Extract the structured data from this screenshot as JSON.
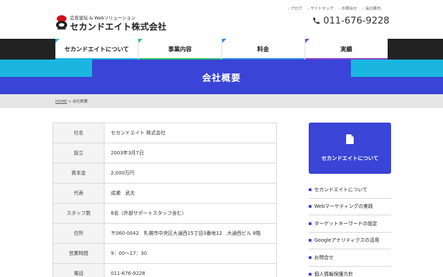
{
  "header": {
    "logo_tagline": "広告宣伝 & Webソリューション",
    "logo_name": "セカンドエイト株式会社",
    "top_links": [
      "ブログ",
      "サイトマップ",
      "お問合せ",
      "会社案内"
    ],
    "phone": "011-676-9228"
  },
  "nav": {
    "items": [
      {
        "label": "セカンドエイトについて",
        "color": "#1bb6e0"
      },
      {
        "label": "事業内容",
        "color": "#2fbf71"
      },
      {
        "label": "料金",
        "color": "#2a8be8"
      },
      {
        "label": "実績",
        "color": "#8a3fd1"
      }
    ]
  },
  "hero": {
    "title": "会社概要"
  },
  "breadcrumb": {
    "home": "HOME",
    "separator": ">",
    "current": "会社概要"
  },
  "company_table": {
    "rows": [
      {
        "label": "社名",
        "value": "セカンドエイト 株式会社"
      },
      {
        "label": "設立",
        "value": "2003年3月7日"
      },
      {
        "label": "資本金",
        "value": "2,000万円"
      },
      {
        "label": "代表",
        "value": "成瀬　武夫"
      },
      {
        "label": "スタッフ数",
        "value": "8名（外部サポートスタッフ含む）"
      },
      {
        "label": "住所",
        "value": "〒060-0042　札幌市中央区大通西15丁目3番地12　大通西ビル 8階"
      },
      {
        "label": "営業時間",
        "value": "9：00〜17：30"
      },
      {
        "label": "電話",
        "value": "011-676-9228"
      }
    ]
  },
  "sidebar": {
    "card_title": "セカンドエイトについて",
    "items": [
      "セカンドエイトについて",
      "Webマーケティングの実践",
      "ターゲットキーワードの設定",
      "Googleアナリティクスの活用",
      "お問合せ",
      "個人情報保護方針"
    ]
  },
  "colors": {
    "primary": "#3a44d6",
    "accent_cyan": "#1bb6e0",
    "logo_red": "#d0101b"
  }
}
